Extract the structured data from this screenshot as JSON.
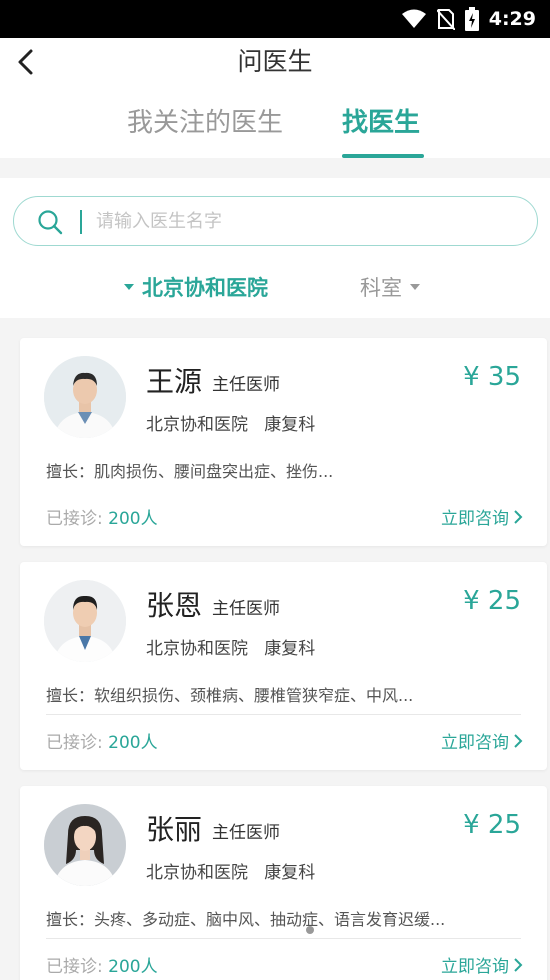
{
  "status_bar": {
    "time": "4:29"
  },
  "header": {
    "title": "问医生",
    "tabs": [
      {
        "label": "我关注的医生",
        "active": false
      },
      {
        "label": "找医生",
        "active": true
      }
    ]
  },
  "search": {
    "placeholder": "请输入医生名字",
    "value": ""
  },
  "filters": {
    "hospital": "北京协和医院",
    "department": "科室"
  },
  "labels": {
    "consulted_prefix": "已接诊: ",
    "consult_button": "立即咨询"
  },
  "doctors": [
    {
      "name": "王源",
      "title": "主任医师",
      "price": "¥ 35",
      "hospital": "北京协和医院",
      "department": "康复科",
      "specialty": "擅长：肌肉损伤、腰间盘突出症、挫伤...",
      "consulted": "200人"
    },
    {
      "name": "张恩",
      "title": "主任医师",
      "price": "¥ 25",
      "hospital": "北京协和医院",
      "department": "康复科",
      "specialty": "擅长：软组织损伤、颈椎病、腰椎管狭窄症、中风...",
      "consulted": "200人"
    },
    {
      "name": "张丽",
      "title": "主任医师",
      "price": "¥ 25",
      "hospital": "北京协和医院",
      "department": "康复科",
      "specialty": "擅长：头疼、多动症、脑中风、抽动症、语言发育迟缓...",
      "consulted": "200人"
    }
  ],
  "colors": {
    "accent": "#2aa698",
    "background": "#f4f4f4"
  }
}
